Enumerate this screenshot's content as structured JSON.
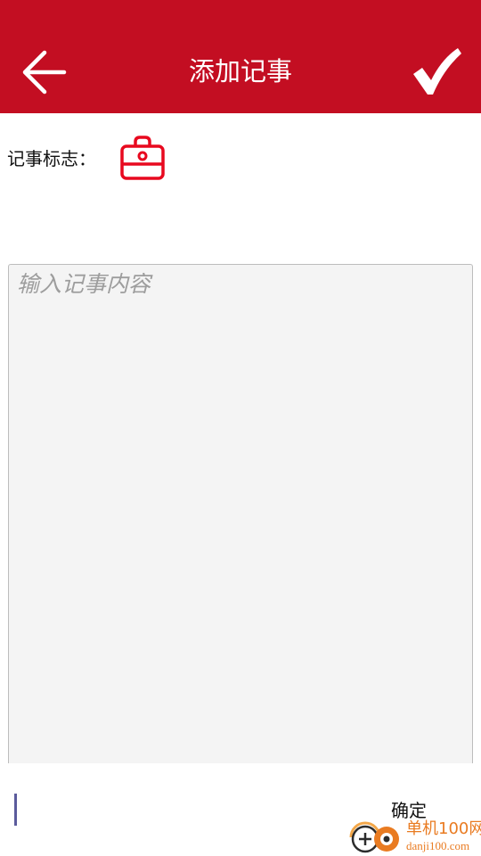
{
  "header": {
    "title": "添加记事",
    "back_icon": "arrow-left-icon",
    "confirm_icon": "checkmark-icon",
    "background_color": "#c30e22",
    "text_color": "#ffffff"
  },
  "mark": {
    "label": "记事标志：",
    "icon": "briefcase-icon",
    "icon_color": "#e8091f"
  },
  "content": {
    "placeholder": "输入记事内容",
    "value": ""
  },
  "bottom": {
    "confirm_label": "确定"
  },
  "watermark": {
    "name": "单机100网",
    "domain": "danji100.com"
  }
}
